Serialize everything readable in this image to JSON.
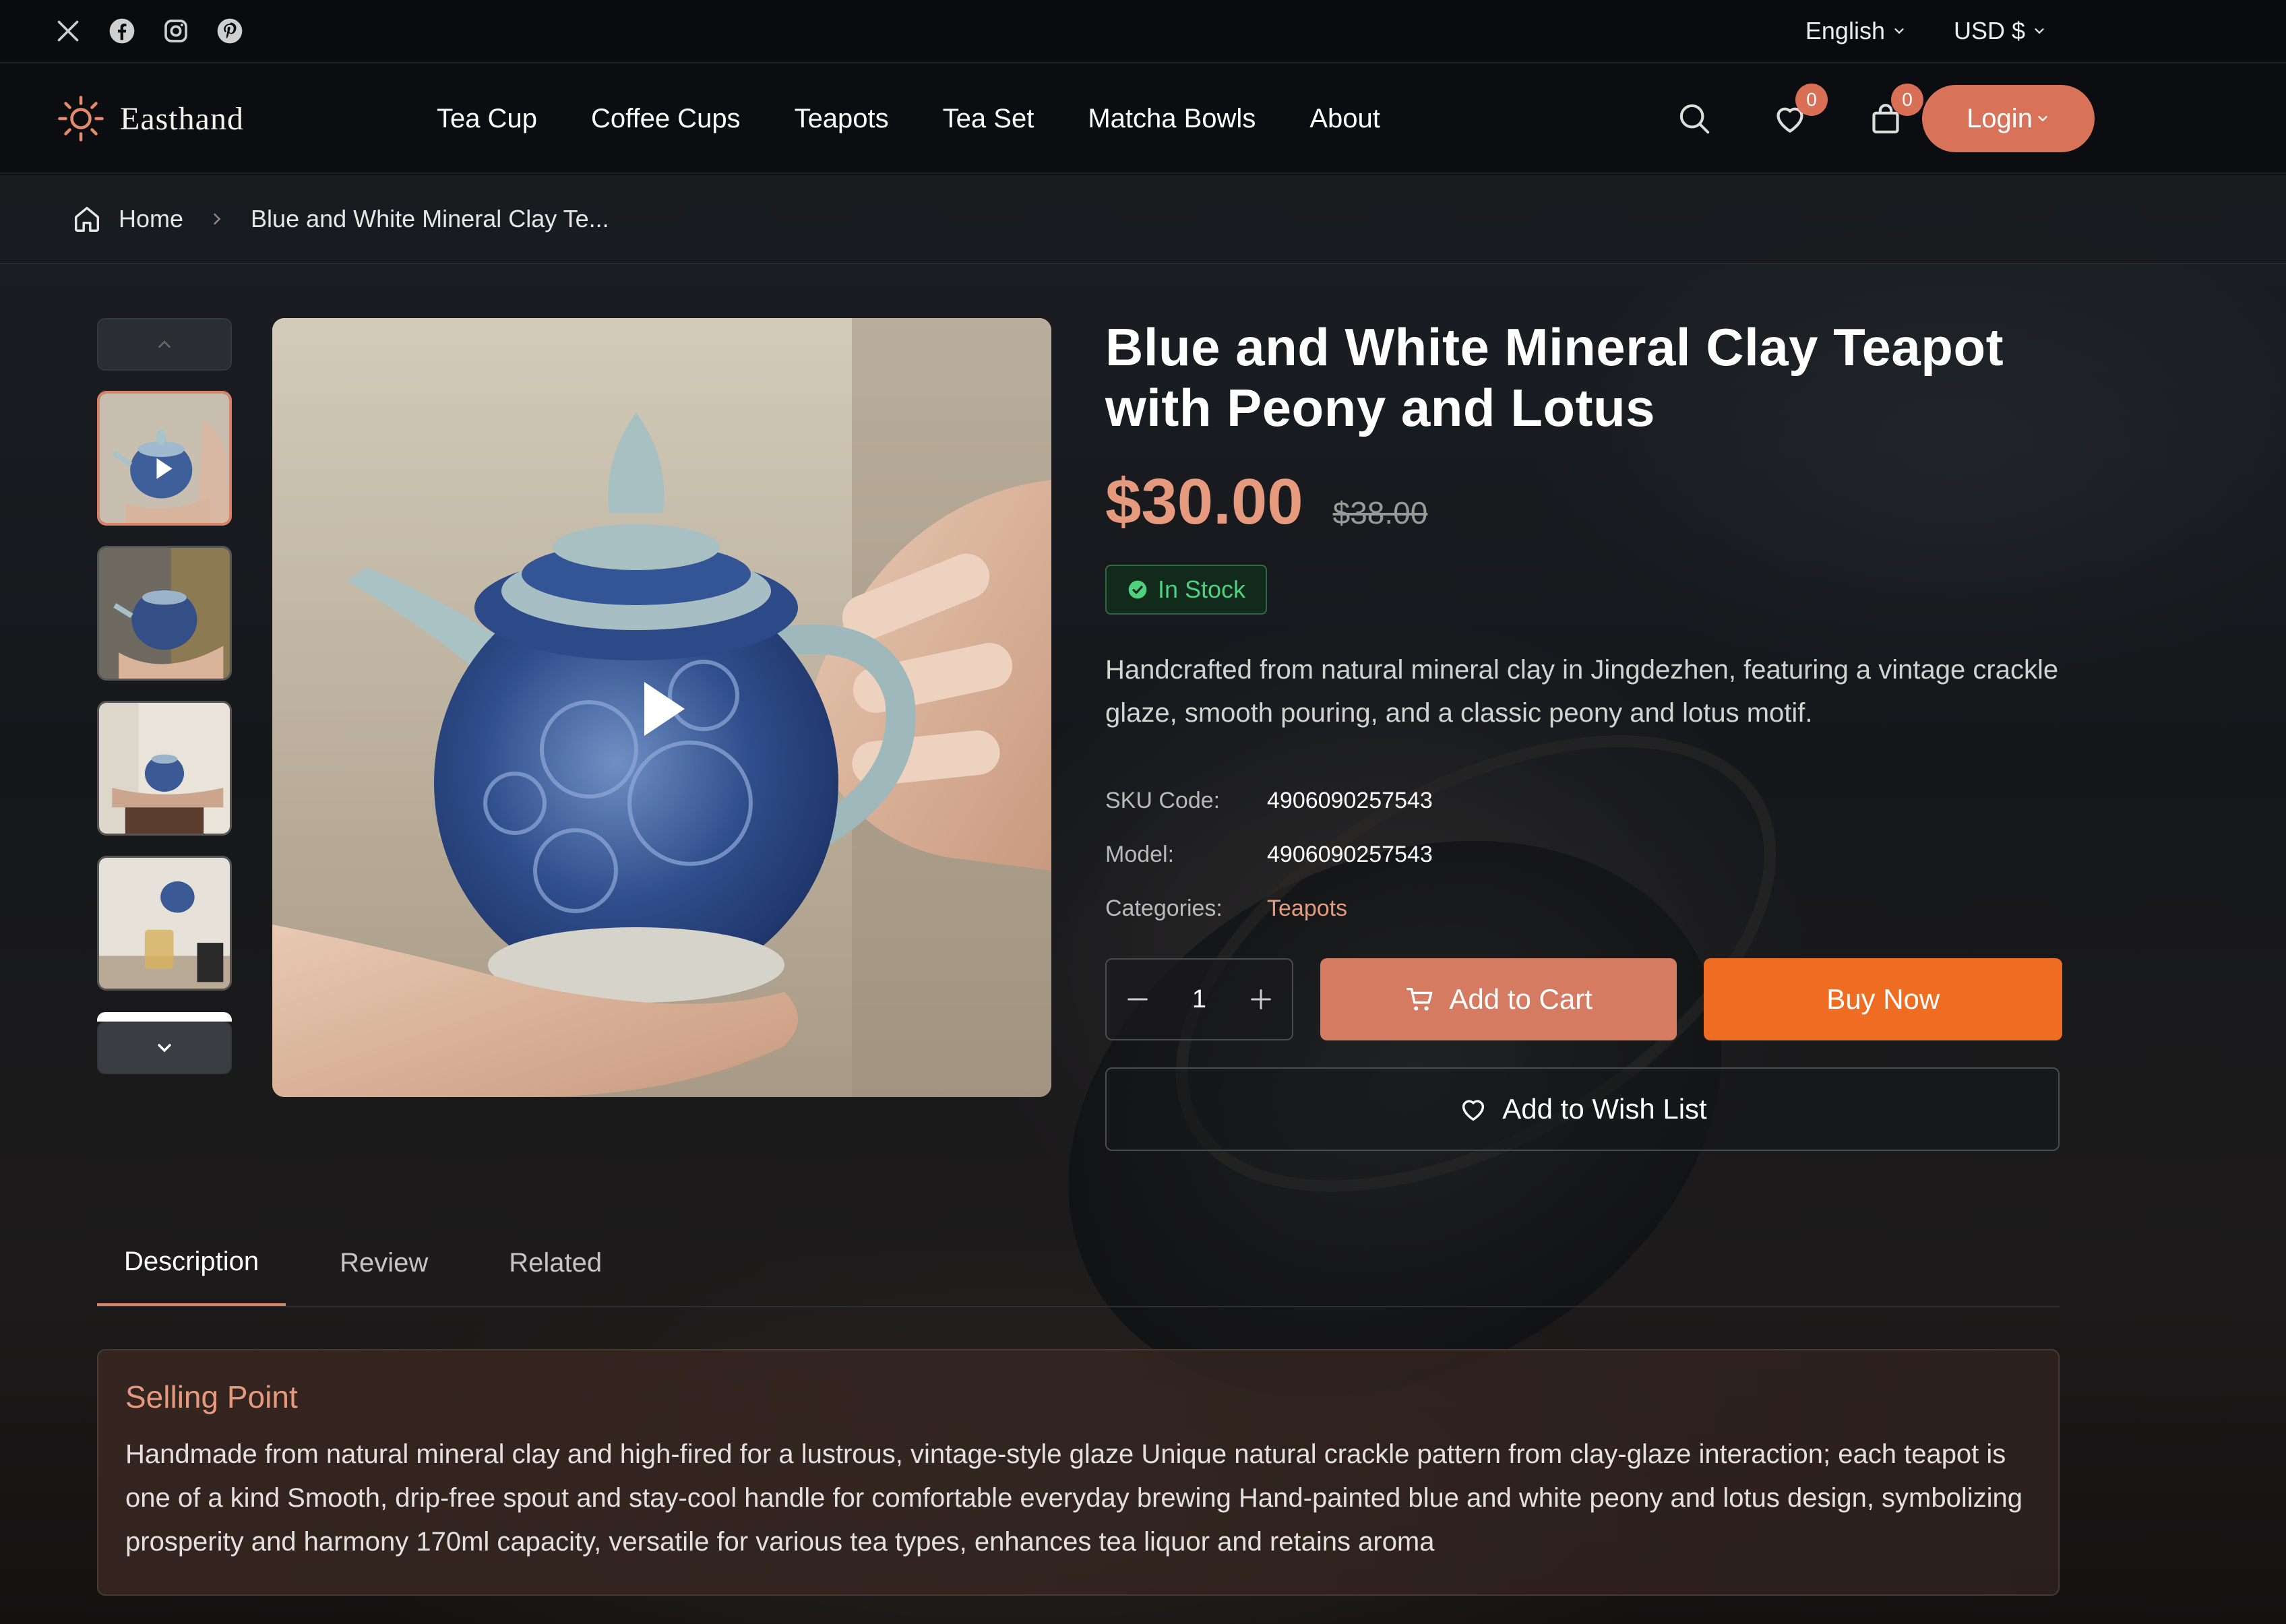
{
  "topbar": {
    "social": [
      "x-icon",
      "facebook-icon",
      "instagram-icon",
      "pinterest-icon"
    ],
    "language": "English",
    "currency": "USD $"
  },
  "nav": {
    "brand": "Easthand",
    "menu": [
      "Tea Cup",
      "Coffee Cups",
      "Teapots",
      "Tea Set",
      "Matcha Bowls",
      "About"
    ],
    "wishlist_count": "0",
    "cart_count": "0",
    "login_label": "Login"
  },
  "breadcrumb": {
    "home": "Home",
    "current": "Blue and White Mineral Clay Te..."
  },
  "gallery": {
    "thumb_count": 4,
    "active_index": 0
  },
  "product": {
    "title": "Blue and White Mineral Clay Teapot with Peony and Lotus",
    "price": "$30.00",
    "old_price": "$38.00",
    "stock": "In Stock",
    "description": "Handcrafted from natural mineral clay in Jingdezhen, featuring a vintage crackle glaze, smooth pouring, and a classic peony and lotus motif.",
    "specs": [
      {
        "key": "SKU Code:",
        "value": "4906090257543"
      },
      {
        "key": "Model:",
        "value": "4906090257543"
      },
      {
        "key": "Categories:",
        "value": "Teapots"
      }
    ],
    "quantity": "1",
    "add_to_cart": "Add to Cart",
    "buy_now": "Buy Now",
    "add_to_wishlist": "Add to Wish List"
  },
  "tabs": [
    "Description",
    "Review",
    "Related"
  ],
  "selling_point": {
    "title": "Selling Point",
    "text": "Handmade from natural mineral clay and high-fired for a lustrous, vintage-style glaze Unique natural crackle pattern from clay-glaze interaction; each teapot is one of a kind Smooth, drip-free spout and stay-cool handle for comfortable everyday brewing Hand-painted blue and white peony and lotus design, symbolizing prosperity and harmony 170ml capacity, versatile for various tea types, enhances tea liquor and retains aroma"
  },
  "colors": {
    "accent": "#d8735a",
    "price": "#e59a7d",
    "buy_now": "#ee6d22",
    "in_stock": "#4fd07f"
  }
}
